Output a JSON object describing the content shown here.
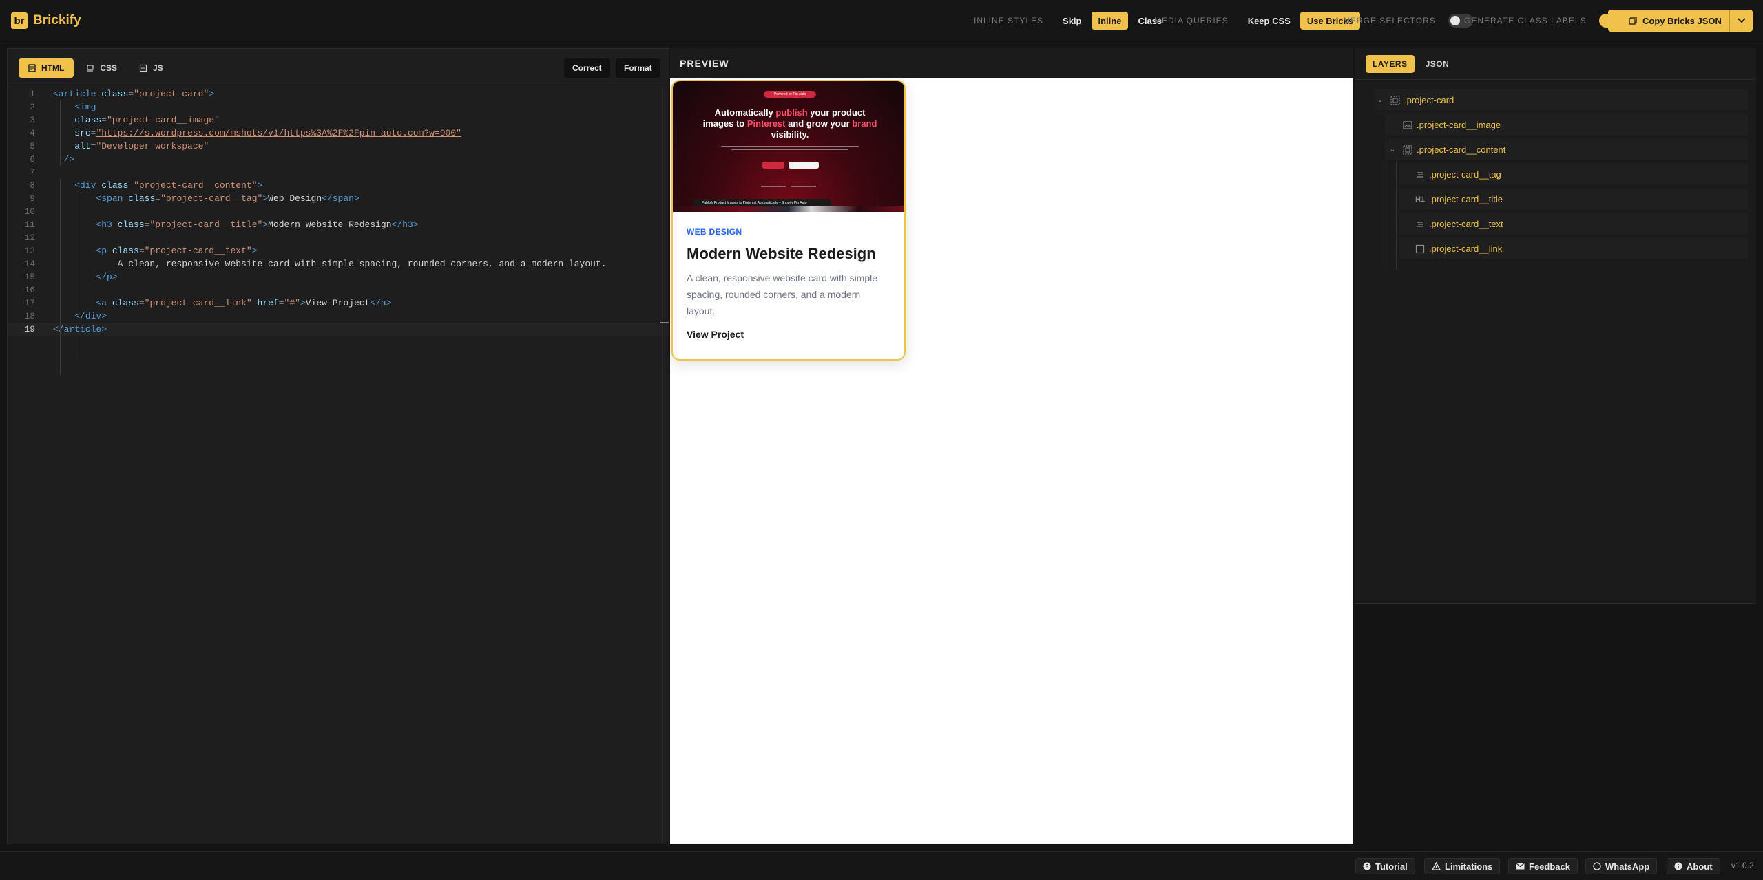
{
  "brand": {
    "logo_text": "br",
    "name": "Brickify"
  },
  "toolbar": {
    "inline_styles": {
      "label": "INLINE STYLES",
      "options": [
        "Skip",
        "Inline",
        "Class"
      ],
      "selected": "Inline"
    },
    "media_queries": {
      "label": "MEDIA QUERIES",
      "options": [
        "Keep CSS",
        "Use Bricks"
      ],
      "selected": "Use Bricks"
    },
    "merge_selectors": {
      "label": "MERGE SELECTORS",
      "on": false
    },
    "generate_class_labels": {
      "label": "GENERATE CLASS LABELS",
      "on": true
    },
    "copy_label": "Copy Bricks JSON"
  },
  "editor": {
    "tabs": [
      {
        "label": "HTML",
        "icon": "html-file-icon",
        "active": true
      },
      {
        "label": "CSS",
        "icon": "css-file-icon",
        "active": false
      },
      {
        "label": "JS",
        "icon": "js-file-icon",
        "active": false
      }
    ],
    "actions": {
      "correct": "Correct",
      "format": "Format"
    },
    "line_numbers": [
      "1",
      "2",
      "3",
      "4",
      "5",
      "6",
      "7",
      "8",
      "9",
      "10",
      "11",
      "12",
      "13",
      "14",
      "15",
      "16",
      "17",
      "18",
      "19"
    ],
    "current_line": "19",
    "code_lines": [
      "<article class=\"project-card\">",
      "    <img",
      "    class=\"project-card__image\"",
      "    src=\"https://s.wordpress.com/mshots/v1/https%3A%2F%2Fpin-auto.com?w=900\"",
      "    alt=\"Developer workspace\"",
      "  />",
      "",
      "    <div class=\"project-card__content\">",
      "        <span class=\"project-card__tag\">Web Design</span>",
      "",
      "        <h3 class=\"project-card__title\">Modern Website Redesign</h3>",
      "",
      "        <p class=\"project-card__text\">",
      "            A clean, responsive website card with simple spacing, rounded corners, and a modern layout.",
      "        </p>",
      "",
      "        <a class=\"project-card__link\" href=\"#\">View Project</a>",
      "    </div>",
      "</article>"
    ]
  },
  "preview": {
    "header": "PREVIEW",
    "card": {
      "image": {
        "pill": "Powered by Pin Auto",
        "headline_parts": [
          "Automatically ",
          "publish",
          " your product images to ",
          "Pinterest",
          " and grow your ",
          "brand",
          " visibility."
        ],
        "bar_text": "Publish Product Images to Pinterest Automatically – Shopify Pin Auto"
      },
      "tag": "Web Design",
      "title": "Modern Website Redesign",
      "text": "A clean, responsive website card with simple spacing, rounded corners, and a modern layout.",
      "link": "View Project"
    }
  },
  "layers": {
    "tabs": [
      {
        "label": "LAYERS",
        "active": true
      },
      {
        "label": "JSON",
        "active": false
      }
    ],
    "items": [
      {
        "label": ".project-card",
        "icon": "container-icon",
        "depth": 0,
        "expandable": true
      },
      {
        "label": ".project-card__image",
        "icon": "image-icon",
        "depth": 1,
        "expandable": false
      },
      {
        "label": ".project-card__content",
        "icon": "container-icon",
        "depth": 1,
        "expandable": true
      },
      {
        "label": ".project-card__tag",
        "icon": "text-icon",
        "depth": 2,
        "expandable": false
      },
      {
        "label": ".project-card__title",
        "icon": "heading-icon",
        "icon_text": "H1",
        "depth": 2,
        "expandable": false
      },
      {
        "label": ".project-card__text",
        "icon": "text-icon",
        "depth": 2,
        "expandable": false
      },
      {
        "label": ".project-card__link",
        "icon": "link-box-icon",
        "depth": 2,
        "expandable": false
      }
    ]
  },
  "footer": {
    "buttons": [
      {
        "label": "Tutorial",
        "icon": "question-circle-icon"
      },
      {
        "label": "Limitations",
        "icon": "warning-icon"
      },
      {
        "label": "Feedback",
        "icon": "mail-icon"
      },
      {
        "label": "WhatsApp",
        "icon": "whatsapp-icon"
      },
      {
        "label": "About",
        "icon": "info-circle-icon"
      }
    ],
    "version": "v1.0.2"
  },
  "colors": {
    "accent": "#f0c14b",
    "background": "#141414",
    "panel": "#1e1e1e",
    "tag_blue": "#2563eb"
  }
}
